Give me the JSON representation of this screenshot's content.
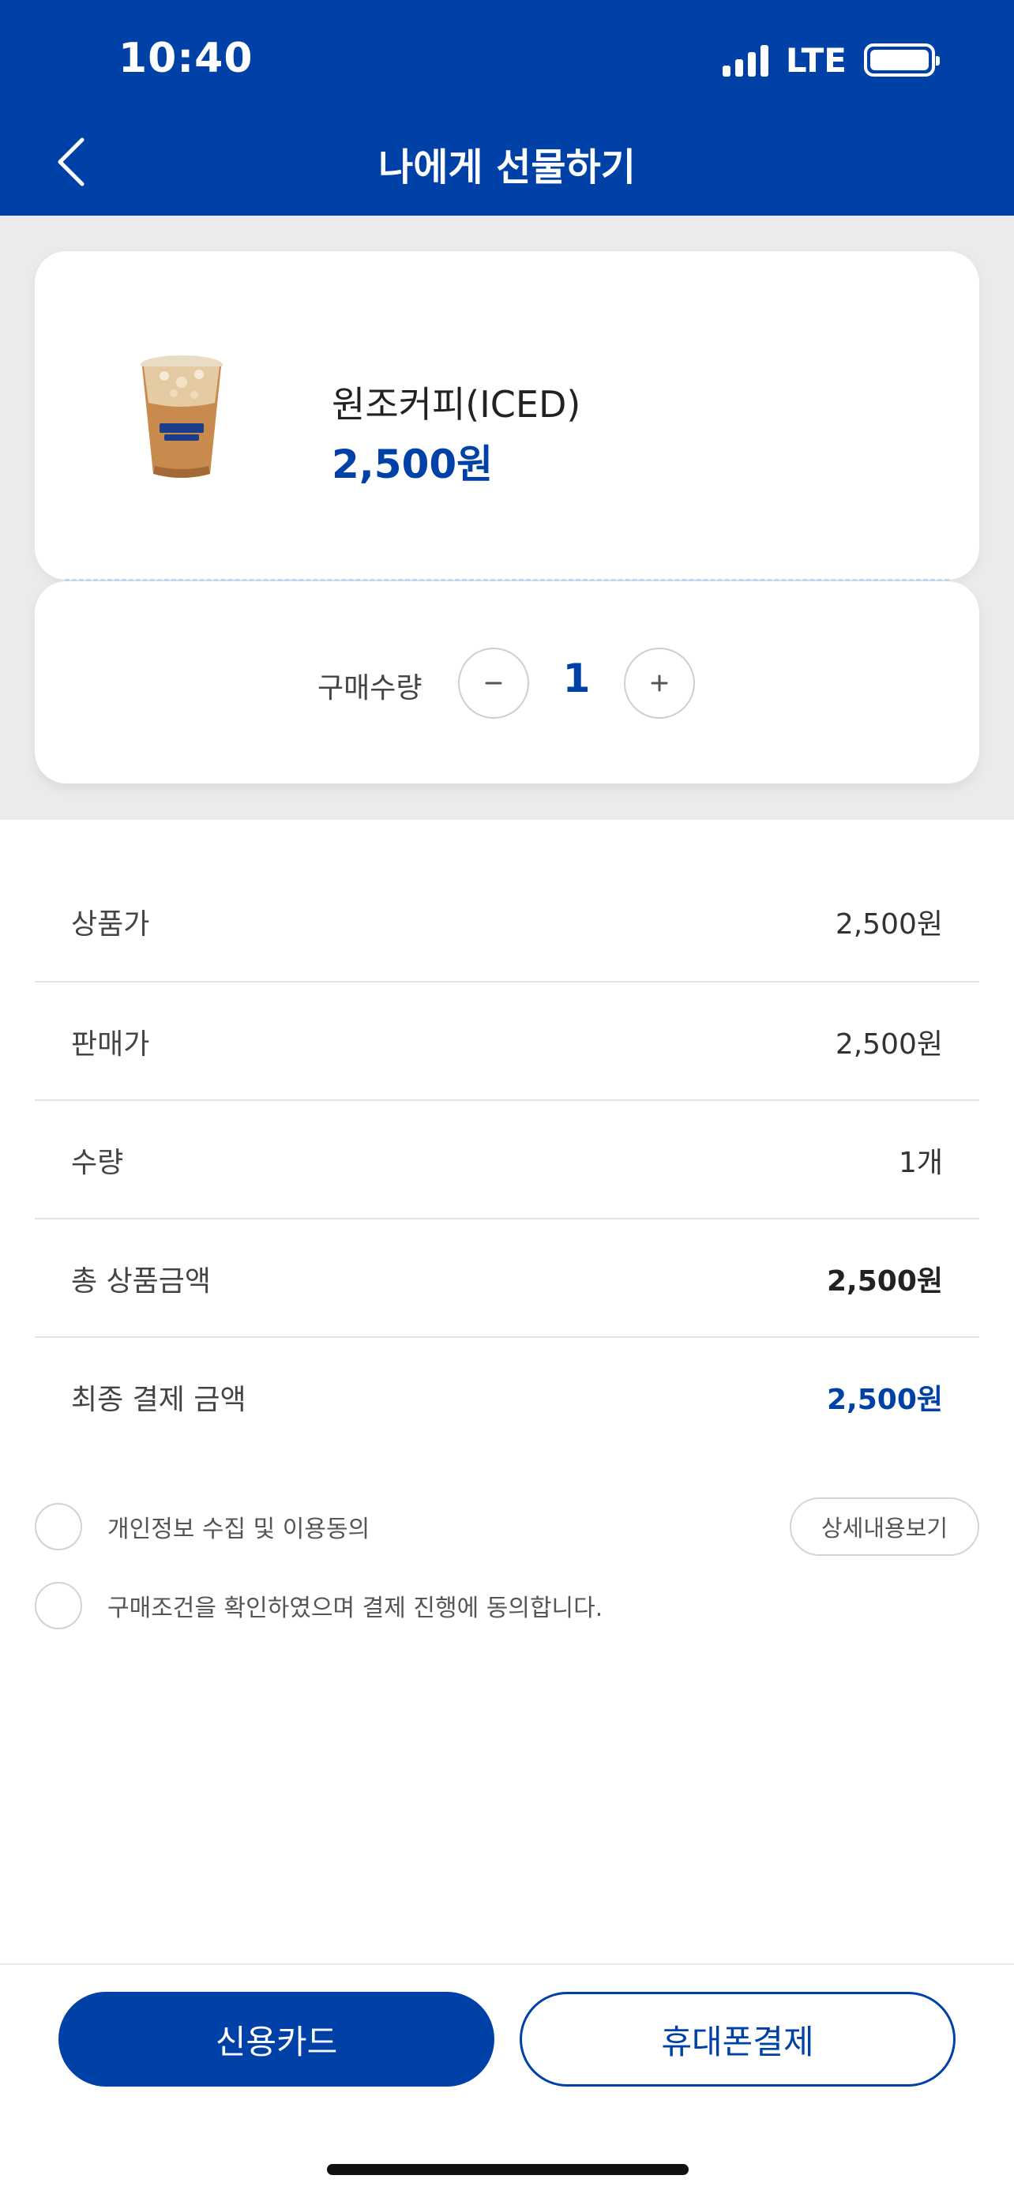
{
  "status_bar": {
    "time": "10:40",
    "network": "LTE",
    "signal_bars": 4,
    "battery_level": 1.0
  },
  "header": {
    "title": "나에게 선물하기",
    "back_icon": "chevron-left-icon",
    "background_color": "#0041a8"
  },
  "product": {
    "name": "원조커피(ICED)",
    "price": "2,500원",
    "image": "iced-coffee-cup"
  },
  "quantity": {
    "label": "구매수량",
    "value": "1",
    "minus_icon": "minus-icon",
    "plus_icon": "plus-icon"
  },
  "summary": {
    "rows": [
      {
        "label": "상품가",
        "value": "2,500원"
      },
      {
        "label": "판매가",
        "value": "2,500원"
      },
      {
        "label": "수량",
        "value": "1개"
      },
      {
        "label": "총 상품금액",
        "value": "2,500원"
      },
      {
        "label": "최종 결제 금액",
        "value": "2,500원"
      }
    ]
  },
  "agreements": {
    "privacy": "개인정보 수집 및 이용동의",
    "detail_button": "상세내용보기",
    "purchase": "구매조건을 확인하였으며 결제 진행에 동의합니다."
  },
  "payment": {
    "card_label": "신용카드",
    "phone_label": "휴대폰결제"
  },
  "colors": {
    "accent": "#0041a8",
    "background_band": "#ebebeb"
  }
}
